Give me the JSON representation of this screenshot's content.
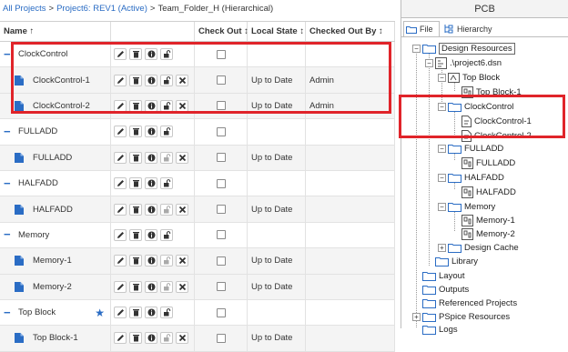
{
  "breadcrumb": {
    "all_projects": "All Projects",
    "project": "Project6: REV1 (Active)",
    "folder": "Team_Folder_H (Hierarchical)",
    "separator": ">"
  },
  "table": {
    "headers": {
      "name": "Name ↑",
      "check_out": "Check Out ↕",
      "local_state": "Local State ↕",
      "checked_out_by": "Checked Out By ↕"
    },
    "rows": [
      {
        "type": "folder",
        "name": "ClockControl",
        "collapse": "−",
        "state": "",
        "by": ""
      },
      {
        "type": "file",
        "name": "ClockControl-1",
        "state": "Up to Date",
        "by": "Admin"
      },
      {
        "type": "file",
        "name": "ClockControl-2",
        "state": "Up to Date",
        "by": "Admin"
      },
      {
        "type": "folder",
        "name": "FULLADD",
        "collapse": "−",
        "state": "",
        "by": ""
      },
      {
        "type": "file",
        "name": "FULLADD",
        "state": "Up to Date",
        "by": ""
      },
      {
        "type": "folder",
        "name": "HALFADD",
        "collapse": "−",
        "state": "",
        "by": ""
      },
      {
        "type": "file",
        "name": "HALFADD",
        "state": "Up to Date",
        "by": ""
      },
      {
        "type": "folder",
        "name": "Memory",
        "collapse": "−",
        "state": "",
        "by": ""
      },
      {
        "type": "file",
        "name": "Memory-1",
        "state": "Up to Date",
        "by": ""
      },
      {
        "type": "file",
        "name": "Memory-2",
        "state": "Up to Date",
        "by": ""
      },
      {
        "type": "folder",
        "name": "Top Block",
        "collapse": "−",
        "state": "",
        "by": "",
        "star": "★"
      },
      {
        "type": "file",
        "name": "Top Block-1",
        "state": "Up to Date",
        "by": ""
      }
    ]
  },
  "pcb_panel": {
    "title": "PCB",
    "tabs": {
      "file": "File",
      "hierarchy": "Hierarchy"
    },
    "tree": {
      "design_resources": "Design Resources",
      "dsn": ".\\project6.dsn",
      "top_block": "Top Block",
      "top_block_1": "Top Block-1",
      "clockcontrol": "ClockControl",
      "clockcontrol_1": "ClockControl-1",
      "clockcontrol_2": "ClockControl-2",
      "fulladd": "FULLADD",
      "fulladd_1": "FULLADD",
      "halfadd": "HALFADD",
      "halfadd_1": "HALFADD",
      "memory": "Memory",
      "memory_1": "Memory-1",
      "memory_2": "Memory-2",
      "design_cache": "Design Cache",
      "library": "Library",
      "layout": "Layout",
      "outputs": "Outputs",
      "referenced_projects": "Referenced Projects",
      "pspice_resources": "PSpice Resources",
      "logs": "Logs"
    }
  },
  "colors": {
    "accent": "#2a6cc4",
    "highlight": "#e0242a",
    "folder_icon": "#2a6cc4"
  }
}
